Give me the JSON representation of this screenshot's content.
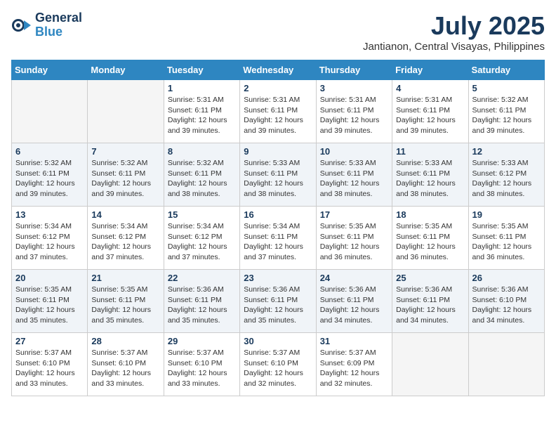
{
  "logo": {
    "general": "General",
    "blue": "Blue"
  },
  "header": {
    "month": "July 2025",
    "location": "Jantianon, Central Visayas, Philippines"
  },
  "days_of_week": [
    "Sunday",
    "Monday",
    "Tuesday",
    "Wednesday",
    "Thursday",
    "Friday",
    "Saturday"
  ],
  "weeks": [
    [
      {
        "day": "",
        "info": ""
      },
      {
        "day": "",
        "info": ""
      },
      {
        "day": "1",
        "info": "Sunrise: 5:31 AM\nSunset: 6:11 PM\nDaylight: 12 hours and 39 minutes."
      },
      {
        "day": "2",
        "info": "Sunrise: 5:31 AM\nSunset: 6:11 PM\nDaylight: 12 hours and 39 minutes."
      },
      {
        "day": "3",
        "info": "Sunrise: 5:31 AM\nSunset: 6:11 PM\nDaylight: 12 hours and 39 minutes."
      },
      {
        "day": "4",
        "info": "Sunrise: 5:31 AM\nSunset: 6:11 PM\nDaylight: 12 hours and 39 minutes."
      },
      {
        "day": "5",
        "info": "Sunrise: 5:32 AM\nSunset: 6:11 PM\nDaylight: 12 hours and 39 minutes."
      }
    ],
    [
      {
        "day": "6",
        "info": "Sunrise: 5:32 AM\nSunset: 6:11 PM\nDaylight: 12 hours and 39 minutes."
      },
      {
        "day": "7",
        "info": "Sunrise: 5:32 AM\nSunset: 6:11 PM\nDaylight: 12 hours and 39 minutes."
      },
      {
        "day": "8",
        "info": "Sunrise: 5:32 AM\nSunset: 6:11 PM\nDaylight: 12 hours and 38 minutes."
      },
      {
        "day": "9",
        "info": "Sunrise: 5:33 AM\nSunset: 6:11 PM\nDaylight: 12 hours and 38 minutes."
      },
      {
        "day": "10",
        "info": "Sunrise: 5:33 AM\nSunset: 6:11 PM\nDaylight: 12 hours and 38 minutes."
      },
      {
        "day": "11",
        "info": "Sunrise: 5:33 AM\nSunset: 6:11 PM\nDaylight: 12 hours and 38 minutes."
      },
      {
        "day": "12",
        "info": "Sunrise: 5:33 AM\nSunset: 6:12 PM\nDaylight: 12 hours and 38 minutes."
      }
    ],
    [
      {
        "day": "13",
        "info": "Sunrise: 5:34 AM\nSunset: 6:12 PM\nDaylight: 12 hours and 37 minutes."
      },
      {
        "day": "14",
        "info": "Sunrise: 5:34 AM\nSunset: 6:12 PM\nDaylight: 12 hours and 37 minutes."
      },
      {
        "day": "15",
        "info": "Sunrise: 5:34 AM\nSunset: 6:12 PM\nDaylight: 12 hours and 37 minutes."
      },
      {
        "day": "16",
        "info": "Sunrise: 5:34 AM\nSunset: 6:11 PM\nDaylight: 12 hours and 37 minutes."
      },
      {
        "day": "17",
        "info": "Sunrise: 5:35 AM\nSunset: 6:11 PM\nDaylight: 12 hours and 36 minutes."
      },
      {
        "day": "18",
        "info": "Sunrise: 5:35 AM\nSunset: 6:11 PM\nDaylight: 12 hours and 36 minutes."
      },
      {
        "day": "19",
        "info": "Sunrise: 5:35 AM\nSunset: 6:11 PM\nDaylight: 12 hours and 36 minutes."
      }
    ],
    [
      {
        "day": "20",
        "info": "Sunrise: 5:35 AM\nSunset: 6:11 PM\nDaylight: 12 hours and 35 minutes."
      },
      {
        "day": "21",
        "info": "Sunrise: 5:35 AM\nSunset: 6:11 PM\nDaylight: 12 hours and 35 minutes."
      },
      {
        "day": "22",
        "info": "Sunrise: 5:36 AM\nSunset: 6:11 PM\nDaylight: 12 hours and 35 minutes."
      },
      {
        "day": "23",
        "info": "Sunrise: 5:36 AM\nSunset: 6:11 PM\nDaylight: 12 hours and 35 minutes."
      },
      {
        "day": "24",
        "info": "Sunrise: 5:36 AM\nSunset: 6:11 PM\nDaylight: 12 hours and 34 minutes."
      },
      {
        "day": "25",
        "info": "Sunrise: 5:36 AM\nSunset: 6:11 PM\nDaylight: 12 hours and 34 minutes."
      },
      {
        "day": "26",
        "info": "Sunrise: 5:36 AM\nSunset: 6:10 PM\nDaylight: 12 hours and 34 minutes."
      }
    ],
    [
      {
        "day": "27",
        "info": "Sunrise: 5:37 AM\nSunset: 6:10 PM\nDaylight: 12 hours and 33 minutes."
      },
      {
        "day": "28",
        "info": "Sunrise: 5:37 AM\nSunset: 6:10 PM\nDaylight: 12 hours and 33 minutes."
      },
      {
        "day": "29",
        "info": "Sunrise: 5:37 AM\nSunset: 6:10 PM\nDaylight: 12 hours and 33 minutes."
      },
      {
        "day": "30",
        "info": "Sunrise: 5:37 AM\nSunset: 6:10 PM\nDaylight: 12 hours and 32 minutes."
      },
      {
        "day": "31",
        "info": "Sunrise: 5:37 AM\nSunset: 6:09 PM\nDaylight: 12 hours and 32 minutes."
      },
      {
        "day": "",
        "info": ""
      },
      {
        "day": "",
        "info": ""
      }
    ]
  ]
}
